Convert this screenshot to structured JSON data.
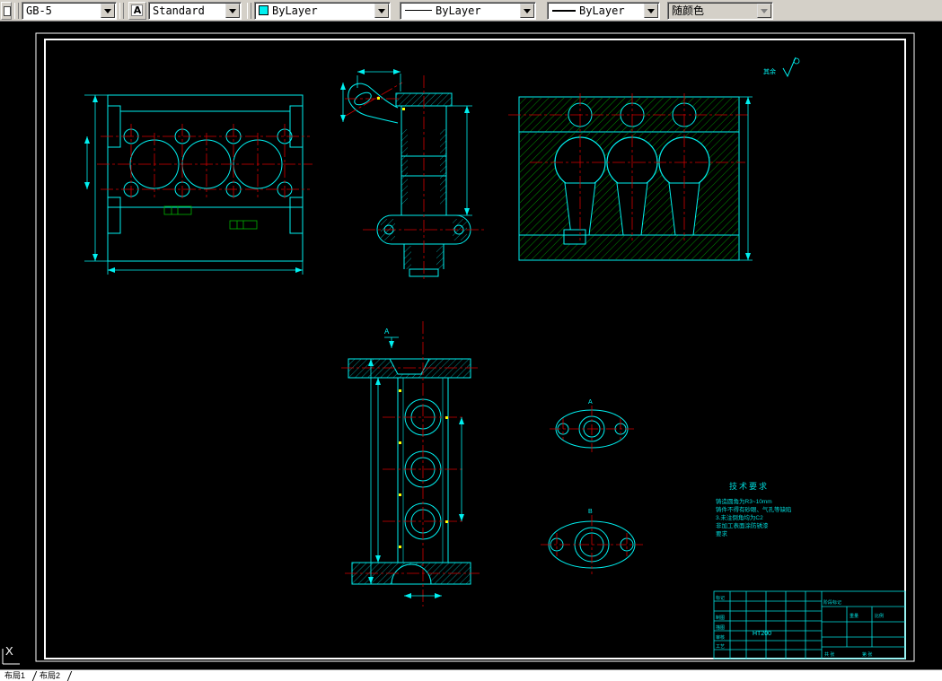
{
  "toolbar": {
    "dim_style": {
      "value": "GB-5"
    },
    "text_style": {
      "value": "Standard"
    },
    "color": {
      "value": "ByLayer",
      "swatch": "#00f0f0"
    },
    "linetype": {
      "value": "ByLayer"
    },
    "lineweight": {
      "value": "ByLayer"
    },
    "plot_style": {
      "value": "随颜色"
    }
  },
  "layout_tabs": [
    {
      "label": "布局1"
    },
    {
      "label": "布局2"
    }
  ],
  "drawing": {
    "surface_note": "其余",
    "section_labels": {
      "top": "A",
      "flange_a": "A",
      "flange_b": "B"
    },
    "tech_requirements": {
      "title": "技术要求",
      "lines": [
        "铸造圆角为R3~10mm",
        "铸件不得有砂眼、气孔等缺陷",
        "3.未注倒角均为C2",
        "非加工表面涂防锈漆",
        "要求"
      ]
    },
    "title_block": {
      "material": "HT200",
      "rows": [
        "标记",
        "制图",
        "描图",
        "审核",
        "工艺"
      ],
      "stage": "阶段标记",
      "weight": "重量",
      "scale": "比例",
      "sheets": "共 张",
      "sheet_no": "第 张"
    },
    "ucs_label": "X"
  },
  "colors": {
    "outline": "#00f0f0",
    "centerline": "#d40000",
    "hatch_green": "#00b400",
    "hatch_cyan": "#00c8c8",
    "highlight": "#ffff00",
    "frame": "#ffffff"
  }
}
